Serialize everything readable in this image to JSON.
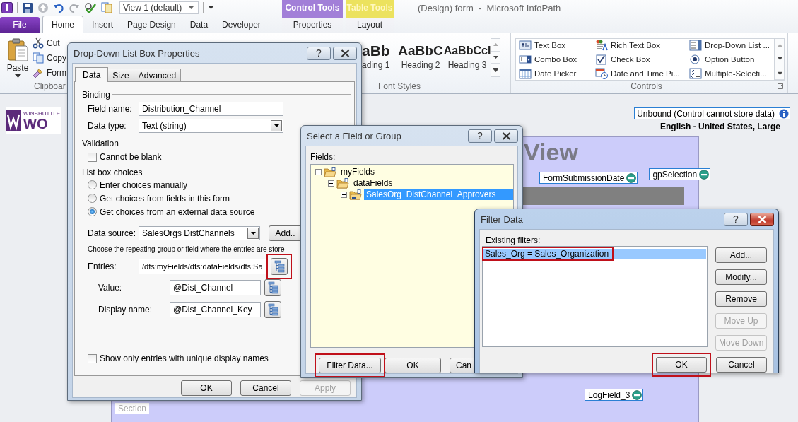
{
  "app": {
    "title": "(Design) form  -  Microsoft InfoPath",
    "view_selector": "View 1 (default)",
    "tabs": [
      {
        "label": "File",
        "kind": "file",
        "selected": false
      },
      {
        "label": "Home",
        "kind": "main",
        "selected": true
      },
      {
        "label": "Insert",
        "kind": "main",
        "selected": false
      },
      {
        "label": "Page Design",
        "kind": "main",
        "selected": false
      },
      {
        "label": "Data",
        "kind": "main",
        "selected": false
      },
      {
        "label": "Developer",
        "kind": "main",
        "selected": false
      }
    ],
    "contextual_tabs": [
      {
        "group": "Control Tools",
        "label": "Properties",
        "color": "#a27fd8",
        "selected": false
      },
      {
        "group": "Table Tools",
        "label": "Layout",
        "color": "#ece25e",
        "selected": false
      }
    ]
  },
  "ribbon": {
    "clipboard": {
      "label": "Clipboar",
      "paste": "Paste",
      "items": [
        "Cut",
        "Copy",
        "Form"
      ]
    },
    "font_styles": {
      "label": "Font Styles",
      "styles": [
        {
          "sample": "aBb",
          "name": "ading 1"
        },
        {
          "sample": "AaBbC",
          "name": "Heading 2"
        },
        {
          "sample": "AaBbCcI",
          "name": "Heading 3"
        }
      ]
    },
    "controls": {
      "label": "Controls",
      "items": [
        "Text Box",
        "Rich Text Box",
        "Drop-Down List ...",
        "Combo Box",
        "Check Box",
        "Option Button",
        "Date Picker",
        "Date and Time Pi...",
        "Multiple-Selecti..."
      ]
    }
  },
  "canvas": {
    "logo": {
      "tagline": "WINSHUTTLE",
      "wordmark": "WO"
    },
    "binding_status": "Unbound (Control cannot store data)",
    "language": "English - United States, Large",
    "view_heading": "View",
    "date_tag": "FormSubmissionDate",
    "selection_tag": "gpSelection",
    "log_tag": "LogField_3",
    "section_label": "Section"
  },
  "dialogs": [
    {
      "kind": "control_properties",
      "title": "Drop-Down List Box Properties",
      "help": "?",
      "active": false,
      "tabs": [
        {
          "label": "Data",
          "selected": true
        },
        {
          "label": "Size",
          "selected": false
        },
        {
          "label": "Advanced",
          "selected": false
        }
      ],
      "binding": {
        "heading": "Binding",
        "field_name_label": "Field name:",
        "field_name": "Distribution_Channel",
        "data_type_label": "Data type:",
        "data_type": "Text (string)"
      },
      "validation": {
        "heading": "Validation",
        "cannot_be_blank": {
          "label": "Cannot be blank",
          "checked": false
        }
      },
      "choices": {
        "heading": "List box choices",
        "options": [
          {
            "label": "Enter choices manually",
            "selected": false
          },
          {
            "label": "Get choices from fields in this form",
            "selected": false
          },
          {
            "label": "Get choices from an external data source",
            "selected": true
          }
        ],
        "data_source_label": "Data source:",
        "data_source": "SalesOrgs DistChannels",
        "add_button": "Add..",
        "instruction": "Choose the repeating group or field where the entries are store",
        "pickers": [
          {
            "kind": "entries",
            "label": "Entries:",
            "value": "/dfs:myFields/dfs:dataFields/dfs:Sa",
            "highlighted": true
          },
          {
            "kind": "attribute",
            "label": "Value:",
            "value": "@Dist_Channel",
            "highlighted": false
          },
          {
            "kind": "attribute",
            "label": "Display name:",
            "value": "@Dist_Channel_Key",
            "highlighted": false
          }
        ],
        "unique": {
          "label": "Show only entries with unique display names",
          "checked": false
        }
      },
      "buttons": [
        {
          "label": "OK",
          "disabled": false
        },
        {
          "label": "Cancel",
          "disabled": false
        },
        {
          "label": "Apply",
          "disabled": true
        }
      ]
    },
    {
      "kind": "field_picker",
      "title": "Select a Field or Group",
      "help": "?",
      "active": false,
      "fields_label": "Fields:",
      "tree": [
        {
          "label": "myFields",
          "expanded": true,
          "selected": false,
          "children": [
            {
              "label": "dataFields",
              "expanded": true,
              "selected": false,
              "children": [
                {
                  "label": "SalesOrg_DistChannel_Approvers",
                  "expanded": false,
                  "selected": true
                }
              ]
            }
          ]
        }
      ],
      "buttons": [
        {
          "label": "Filter Data...",
          "highlighted": true
        },
        {
          "label": "OK",
          "highlighted": false
        },
        {
          "label": "Can",
          "highlighted": false
        }
      ]
    },
    {
      "kind": "filter",
      "title": "Filter Data",
      "help": "?",
      "active": true,
      "list_label": "Existing filters:",
      "filters": [
        {
          "label": "Sales_Org = Sales_Organization",
          "selected": true,
          "highlighted": true
        }
      ],
      "side_buttons": [
        {
          "label": "Add...",
          "disabled": false
        },
        {
          "label": "Modify...",
          "disabled": false
        },
        {
          "label": "Remove",
          "disabled": false
        },
        {
          "label": "Move Up",
          "disabled": true
        },
        {
          "label": "Move Down",
          "disabled": true
        }
      ],
      "buttons": [
        {
          "label": "OK",
          "highlighted": true
        },
        {
          "label": "Cancel",
          "highlighted": false
        }
      ]
    }
  ]
}
